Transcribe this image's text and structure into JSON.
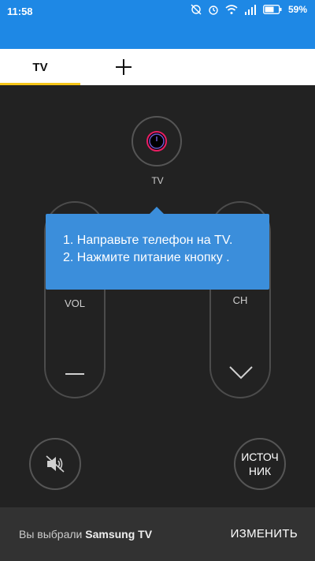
{
  "status_bar": {
    "time": "11:58",
    "battery": "59%"
  },
  "tabs": {
    "active": "TV"
  },
  "remote": {
    "power_label": "TV",
    "vol_label": "VOL",
    "ch_label": "CH",
    "source_line1": "ИСТОЧ",
    "source_line2": "НИК"
  },
  "tooltip": {
    "line1": "1. Направьте телефон на TV.",
    "line2": "2. Нажмите питание кнопку ."
  },
  "snackbar": {
    "prefix": "Вы выбрали",
    "device": "Samsung TV",
    "action": "ИЗМЕНИТЬ"
  },
  "colors": {
    "accent": "#1E88E5",
    "tab_indicator": "#F5C518",
    "tooltip": "#3B8EDB",
    "power_ring": "#E91E63"
  }
}
